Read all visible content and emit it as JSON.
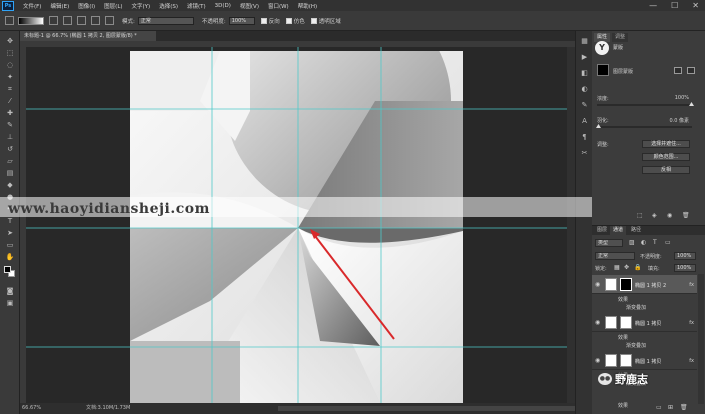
{
  "app": {
    "logo": "Ps",
    "menu": [
      "文件(F)",
      "编辑(E)",
      "图像(I)",
      "图层(L)",
      "文字(Y)",
      "选择(S)",
      "滤镜(T)",
      "3D(D)",
      "视图(V)",
      "窗口(W)",
      "帮助(H)"
    ],
    "window_controls": [
      "—",
      "☐",
      "✕"
    ]
  },
  "options": {
    "mode_label": "模式:",
    "mode_value": "正常",
    "opacity_label": "不透明度:",
    "opacity_value": "100%",
    "reverse_label": "反向",
    "dither_label": "仿色",
    "transparency_label": "透明区域"
  },
  "document": {
    "tab_title": "未标题-1 @ 66.7% (椭圆 1 拷贝 2, 图层蒙版/8) *",
    "zoom": "66.67%",
    "doc_size": "文档:3.10M/1.73M"
  },
  "properties": {
    "tabs": [
      "属性",
      "调整"
    ],
    "chip": "Y",
    "title": "蒙版",
    "subtitle": "图层蒙版",
    "density_label": "浓度:",
    "density_value": "100%",
    "feather_label": "羽化:",
    "feather_value": "0.0 像素",
    "refine_label": "调整:",
    "buttons": [
      "选择并遮住...",
      "颜色范围...",
      "反相"
    ]
  },
  "layers": {
    "tabs": [
      "图层",
      "通道",
      "路径"
    ],
    "filter_value": "类型",
    "blend_value": "正常",
    "opacity_label": "不透明度:",
    "opacity_value": "100%",
    "lock_label": "锁定:",
    "fill_label": "填充:",
    "fill_value": "100%",
    "items": [
      {
        "name": "椭圆 1 拷贝 2",
        "fx": "fx",
        "effects_label": "效果",
        "effect": "渐变叠加",
        "mask_color": "#000000"
      },
      {
        "name": "椭圆 1 拷贝",
        "fx": "fx",
        "effects_label": "效果",
        "effect": "渐变叠加",
        "mask_color": "#ffffff"
      },
      {
        "name": "椭圆 1 拷贝",
        "fx": "fx",
        "effects_label": "效果",
        "effect": "渐变叠加",
        "mask_color": "#ffffff"
      },
      {
        "name": "",
        "fx": "fx",
        "effects_label": "效果",
        "effect": "",
        "mask_color": "#ffffff"
      }
    ]
  },
  "watermark": {
    "url": "www.haoyidiansheji.com",
    "wechat_name": "野鹿志"
  },
  "colors": {
    "guide": "#4fc9c9",
    "arrow": "#d9292b",
    "accent": "#31a8ff"
  }
}
